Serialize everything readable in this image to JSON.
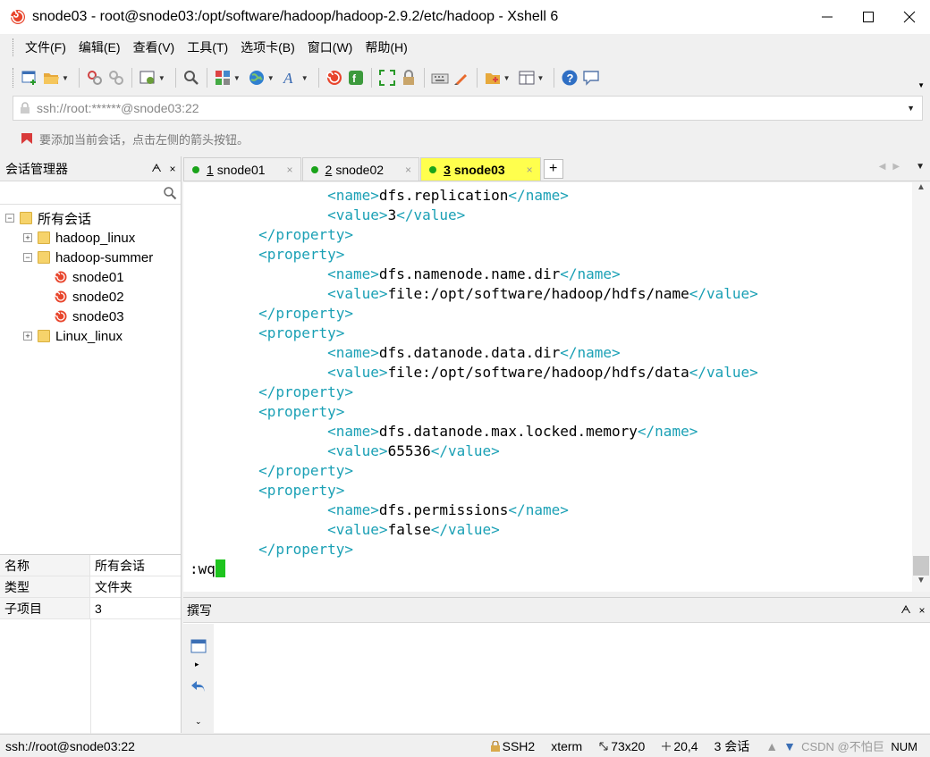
{
  "window": {
    "title": "snode03 - root@snode03:/opt/software/hadoop/hadoop-2.9.2/etc/hadoop - Xshell 6"
  },
  "menu": {
    "items": [
      "文件(F)",
      "编辑(E)",
      "查看(V)",
      "工具(T)",
      "选项卡(B)",
      "窗口(W)",
      "帮助(H)"
    ]
  },
  "address": {
    "value": "ssh://root:******@snode03:22"
  },
  "hint": {
    "text": "要添加当前会话，点击左侧的箭头按钮。"
  },
  "session_panel": {
    "title": "会话管理器",
    "pin_glyph": "ᗅ",
    "close_glyph": "×",
    "search_placeholder": "",
    "tree": {
      "root": "所有会话",
      "groups": [
        "hadoop_linux",
        "hadoop-summer",
        "Linux_linux"
      ],
      "sessions": [
        "snode01",
        "snode02",
        "snode03"
      ]
    },
    "expander_collapsed": "+",
    "expander_expanded": "−"
  },
  "properties": {
    "rows": [
      {
        "key": "名称",
        "value": "所有会话"
      },
      {
        "key": "类型",
        "value": "文件夹"
      },
      {
        "key": "子项目",
        "value": "3"
      }
    ]
  },
  "tabs": [
    {
      "num": "1",
      "name": "snode01",
      "active": false
    },
    {
      "num": "2",
      "name": "snode02",
      "active": false
    },
    {
      "num": "3",
      "name": "snode03",
      "active": true
    }
  ],
  "tab_add_glyph": "+",
  "tab_close_glyph": "×",
  "terminal": {
    "lines": [
      {
        "indent": "                ",
        "tag_open": "<name>",
        "text": "dfs.replication",
        "tag_close": "</name>"
      },
      {
        "indent": "                ",
        "tag_open": "<value>",
        "text": "3",
        "tag_close": "</value>"
      },
      {
        "indent": "        ",
        "tag_open": "</property>",
        "text": "",
        "tag_close": ""
      },
      {
        "indent": "        ",
        "tag_open": "<property>",
        "text": "",
        "tag_close": ""
      },
      {
        "indent": "                ",
        "tag_open": "<name>",
        "text": "dfs.namenode.name.dir",
        "tag_close": "</name>"
      },
      {
        "indent": "                ",
        "tag_open": "<value>",
        "text": "file:/opt/software/hadoop/hdfs/name",
        "tag_close": "</value>"
      },
      {
        "indent": "        ",
        "tag_open": "</property>",
        "text": "",
        "tag_close": ""
      },
      {
        "indent": "        ",
        "tag_open": "<property>",
        "text": "",
        "tag_close": ""
      },
      {
        "indent": "                ",
        "tag_open": "<name>",
        "text": "dfs.datanode.data.dir",
        "tag_close": "</name>"
      },
      {
        "indent": "                ",
        "tag_open": "<value>",
        "text": "file:/opt/software/hadoop/hdfs/data",
        "tag_close": "</value>"
      },
      {
        "indent": "        ",
        "tag_open": "</property>",
        "text": "",
        "tag_close": ""
      },
      {
        "indent": "        ",
        "tag_open": "<property>",
        "text": "",
        "tag_close": ""
      },
      {
        "indent": "                ",
        "tag_open": "<name>",
        "text": "dfs.datanode.max.locked.memory",
        "tag_close": "</name>"
      },
      {
        "indent": "                ",
        "tag_open": "<value>",
        "text": "65536",
        "tag_close": "</value>"
      },
      {
        "indent": "        ",
        "tag_open": "</property>",
        "text": "",
        "tag_close": ""
      },
      {
        "indent": "        ",
        "tag_open": "<property>",
        "text": "",
        "tag_close": ""
      },
      {
        "indent": "                ",
        "tag_open": "<name>",
        "text": "dfs.permissions",
        "tag_close": "</name>"
      },
      {
        "indent": "                ",
        "tag_open": "<value>",
        "text": "false",
        "tag_close": "</value>"
      },
      {
        "indent": "        ",
        "tag_open": "</property>",
        "text": "",
        "tag_close": ""
      }
    ],
    "command": ":wq"
  },
  "compose": {
    "title": "撰写",
    "pin_glyph": "ᗅ",
    "close_glyph": "×"
  },
  "status": {
    "connection": "ssh://root@snode03:22",
    "protocol": "SSH2",
    "terminal_type": "xterm",
    "size": "73x20",
    "cursor_pos": "20,4",
    "sessions": "3 会话",
    "num": "NUM",
    "watermark": "CSDN @不怕巨"
  },
  "colors": {
    "xml_tag": "#1aa0b5",
    "active_tab": "#ffff4d",
    "cursor": "#1ec41e",
    "session_dot": "#1aa31a"
  }
}
